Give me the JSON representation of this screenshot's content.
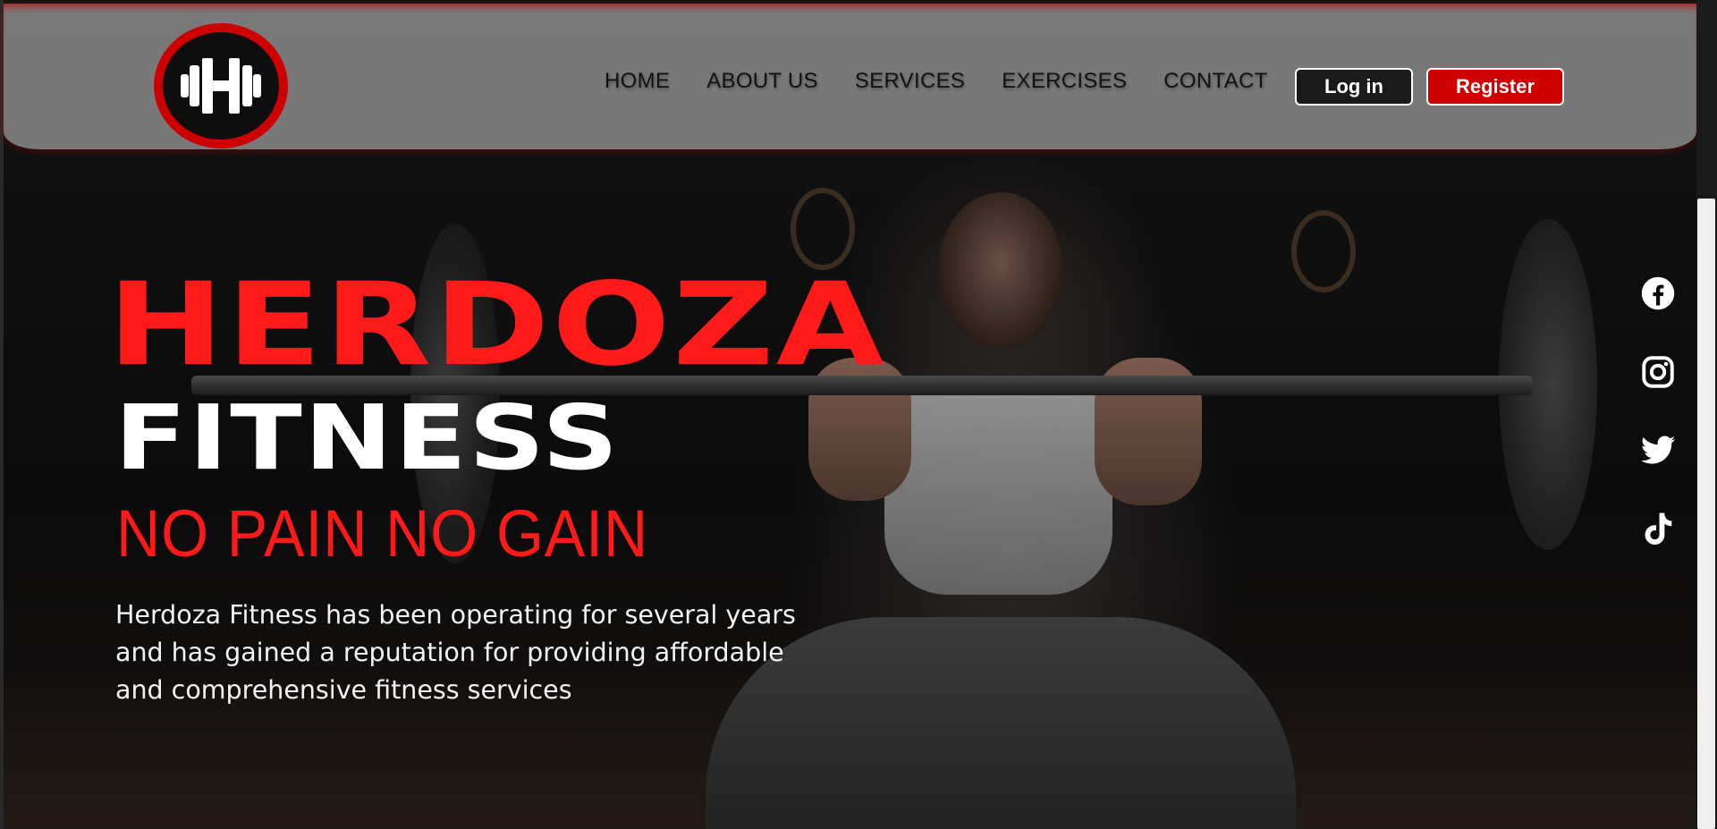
{
  "brand": {
    "logo_icon": "dumbbell-h-icon",
    "logo_letter": "H",
    "accent_color": "#ff1a1a",
    "header_color": "#969696"
  },
  "nav": {
    "items": [
      {
        "label": "HOME"
      },
      {
        "label": "ABOUT US"
      },
      {
        "label": "SERVICES"
      },
      {
        "label": "EXERCISES"
      },
      {
        "label": "CONTACT"
      }
    ]
  },
  "auth": {
    "login_label": "Log in",
    "register_label": "Register"
  },
  "hero": {
    "title": "HERDOZA",
    "subtitle": "FITNESS",
    "tagline": "NO PAIN NO GAIN",
    "description_lines": [
      "Herdoza Fitness has been operating for several years",
      "and has gained a reputation for providing affordable",
      "and comprehensive fitness services"
    ]
  },
  "social": [
    {
      "icon": "facebook-icon"
    },
    {
      "icon": "instagram-icon"
    },
    {
      "icon": "twitter-icon"
    },
    {
      "icon": "tiktok-icon"
    }
  ]
}
